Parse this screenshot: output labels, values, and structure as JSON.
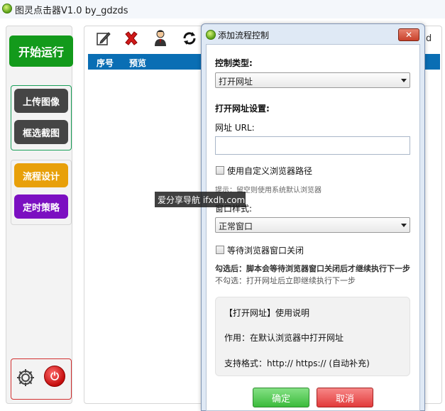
{
  "window": {
    "title": "图灵点击器V1.0 by_gdzds"
  },
  "sidebar": {
    "start_button": "开始运行",
    "upload_button": "上传图像",
    "crop_button": "框选截图",
    "flow_button": "流程设计",
    "schedule_button": "定时策略",
    "power_symbol": "⏻"
  },
  "table": {
    "columns": [
      "序号",
      "预览"
    ]
  },
  "edge_text": "d",
  "dialog": {
    "title": "添加流程控制",
    "close_symbol": "✕",
    "control_type_label": "控制类型:",
    "control_type_value": "打开网址",
    "section_title": "打开网址设置:",
    "url_label": "网址 URL:",
    "url_value": "",
    "custom_browser_label": "使用自定义浏览器路径",
    "custom_browser_checked": false,
    "hint": "提示：留空则使用系统默认浏览器",
    "window_style_label": "窗口样式:",
    "window_style_value": "正常窗口",
    "wait_close_label": "等待浏览器窗口关闭",
    "wait_close_checked": false,
    "wait_checked_note": "勾选后：脚本会等待浏览器窗口关闭后才继续执行下一步",
    "wait_unchecked_note": "不勾选：打开网址后立即继续执行下一步",
    "info_title": "【打开网址】使用说明",
    "info_usage": "作用：在默认浏览器中打开网址",
    "info_format": "支持格式：http:// https:// (自动补充)",
    "ok_button": "确定",
    "cancel_button": "取消"
  },
  "watermark": "爱分享导航 ifxdh.com",
  "colors": {
    "start_green": "#139a1b",
    "table_header_blue": "#0a6eb4",
    "flow_orange": "#e8a00a",
    "schedule_purple": "#7b0fc1",
    "ok_green": "#3cbb3c",
    "cancel_red": "#e23b3b"
  },
  "icons": [
    "edit-icon",
    "delete-icon",
    "user-icon",
    "refresh-icon",
    "gear-icon",
    "power-icon"
  ]
}
